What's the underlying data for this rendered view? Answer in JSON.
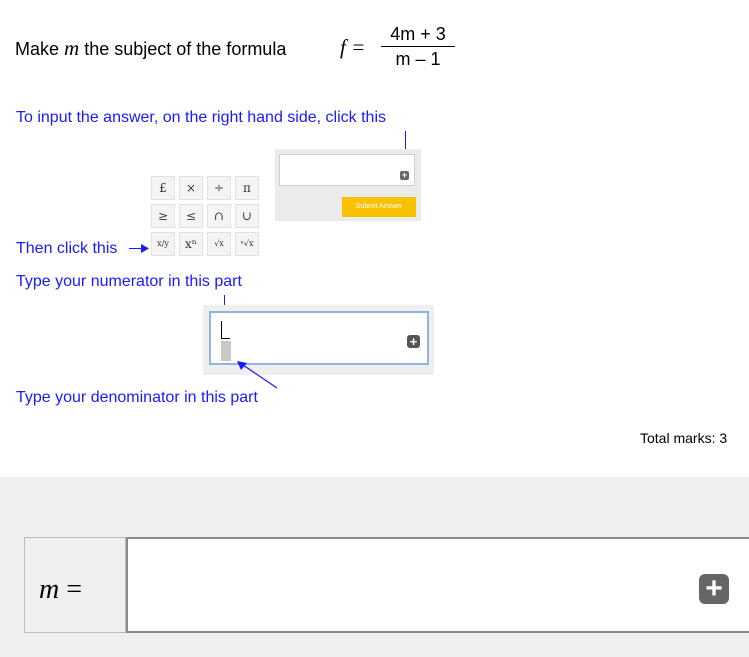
{
  "question": {
    "prefix": "Make",
    "variable": "m",
    "suffix": "the subject of the formula",
    "formula_lhs": "f =",
    "numerator": "4m + 3",
    "denominator": "m – 1"
  },
  "instructions": {
    "step1": "To input the answer, on the right hand side, click this",
    "step2": "Then click this",
    "step3": "Type your numerator in this part",
    "step4": "Type your denominator in this part"
  },
  "mini_panel": {
    "submit_label": "Submit Answer",
    "plus_icon": "+"
  },
  "keypad": {
    "keys": [
      "£",
      "×",
      "÷",
      "π",
      "≥",
      "≤",
      "∩",
      "∪",
      "x/y",
      "xⁿ",
      "√x",
      "ⁿ√x"
    ]
  },
  "big_panel": {
    "plus_icon": "+"
  },
  "total_marks": "Total marks: 3",
  "answer": {
    "label_var": "m",
    "label_eq": "=",
    "value": "",
    "plus_icon": "+"
  },
  "colors": {
    "instruction_blue": "#1a1aff",
    "submit_yellow": "#f7c100"
  }
}
